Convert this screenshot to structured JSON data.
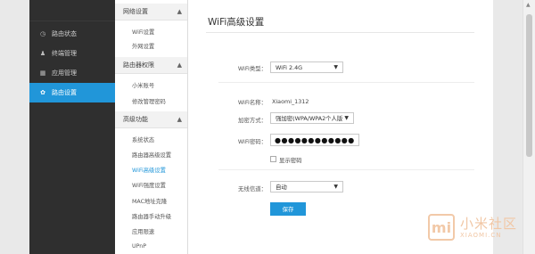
{
  "nav": {
    "items": [
      {
        "label": "路由状态",
        "icon": "clock-icon",
        "glyph": "◷",
        "active": false
      },
      {
        "label": "终端管理",
        "icon": "user-icon",
        "glyph": "♟",
        "active": false
      },
      {
        "label": "应用管理",
        "icon": "grid-icon",
        "glyph": "▦",
        "active": false
      },
      {
        "label": "路由设置",
        "icon": "gear-icon",
        "glyph": "✿",
        "active": true
      }
    ]
  },
  "submenu": {
    "groups": [
      {
        "title": "网络设置",
        "chevron": "▲",
        "items": [
          "WiFi设置",
          "外网设置"
        ]
      },
      {
        "title": "路由器权限",
        "chevron": "▲",
        "items": [
          "小米账号",
          "修改管理密码"
        ]
      },
      {
        "title": "高级功能",
        "chevron": "▲",
        "items": [
          "系统状态",
          "路由器高级设置",
          "WiFi高级设置",
          "WiFi强度设置",
          "MAC地址克隆",
          "路由器手动升级",
          "应用限速",
          "UPnP"
        ]
      }
    ],
    "active_item": "WiFi高级设置"
  },
  "main": {
    "title": "WiFi高级设置",
    "wifi_type_label": "WiFi类型：",
    "wifi_type_value": "WiFi 2.4G",
    "wifi_name_label": "WiFi名称：",
    "wifi_name_value": "Xiaomi_1312",
    "encryption_label": "加密方式：",
    "encryption_value": "强加密(WPA/WPA2个人版",
    "password_label": "WiFi密码：",
    "password_value": "●●●●●●●●●●●●",
    "show_password_label": "显示密码",
    "channel_label": "无线信道：",
    "channel_value": "自动",
    "save_label": "保存",
    "dropdown_arrow": "▼"
  },
  "scrollbar": {
    "up_arrow": "▲"
  },
  "watermark": {
    "text": "小米社区",
    "sub": "XIAOMI.CN",
    "logo": "mi"
  },
  "colors": {
    "accent": "#2196d9",
    "nav_bg": "#2f2f2f"
  }
}
